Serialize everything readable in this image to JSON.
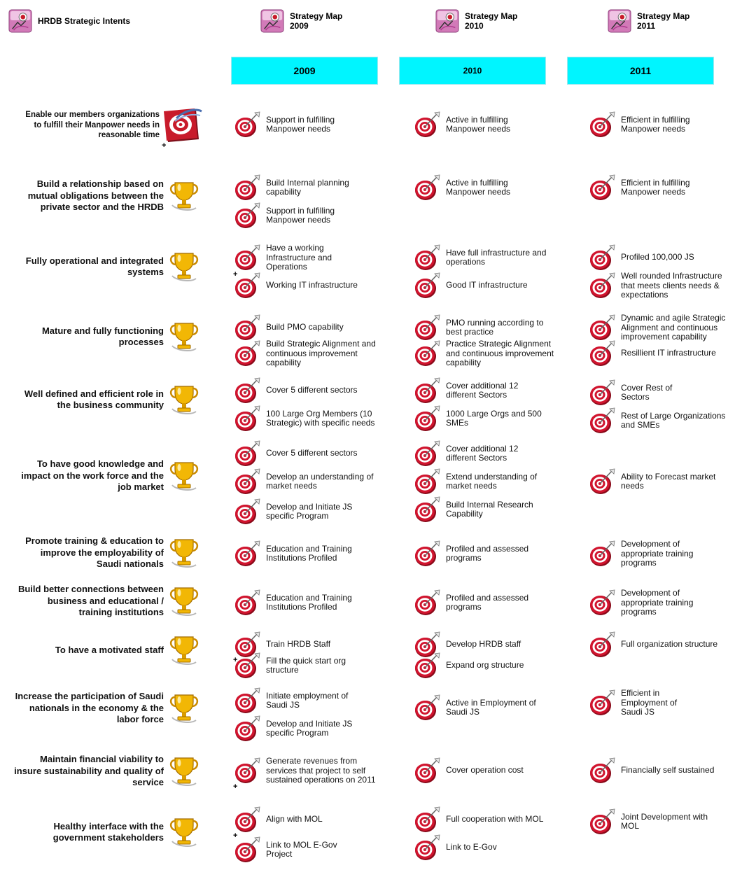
{
  "headers": {
    "intents": "HRDB Strategic Intents",
    "map2009": "Strategy Map\n2009",
    "map2010": "Strategy Map\n2010",
    "map2011": "Strategy Map\n2011"
  },
  "years": [
    "2009",
    "2010",
    "2011"
  ],
  "intents": [
    "Enable our members organizations to fulfill their Manpower  needs in reasonable time",
    "Build a relationship based on mutual obligations between the private sector and the HRDB",
    "Fully operational and integrated systems",
    "Mature and fully functioning processes",
    "Well defined and efficient role in the business community",
    "To have good knowledge and impact on the work force and the job market",
    "Promote training & education to improve the employability of Saudi nationals",
    "Build better connections between business and educational / training institutions",
    "To have a motivated staff",
    "Increase the participation of Saudi nationals in the economy & the labor force",
    "Maintain financial viability to insure sustainability and quality of service",
    "Healthy interface with the government stakeholders"
  ],
  "objectives": {
    "y2009": [
      "Support in fulfilling\nManpower needs",
      "Build Internal planning\ncapability",
      "Support in fulfilling\nManpower needs",
      "Have a working\nInfrastructure and\nOperations",
      "Working IT infrastructure",
      "Build PMO capability",
      "Build Strategic Alignment and\ncontinuous improvement\ncapability",
      "Cover 5 different sectors",
      "100 Large Org Members (10\nStrategic) with specific needs",
      "Cover 5 different sectors",
      "Develop an understanding of\nmarket needs",
      "Develop and Initiate JS\nspecific Program",
      "Education and Training\nInstitutions Profiled",
      "Education and Training\nInstitutions Profiled",
      "Train HRDB Staff",
      "Fill the quick start org\nstructure",
      "Initiate employment of\nSaudi JS",
      "Develop and Initiate JS\nspecific Program",
      "Generate revenues from\nservices that project to self\nsustained operations on 2011",
      "Align with MOL",
      "Link to MOL E-Gov\nProject"
    ],
    "y2010": [
      "Active in fulfilling\nManpower needs",
      "Active in fulfilling\nManpower needs",
      "Have full infrastructure and\noperations",
      "Good IT infrastructure",
      "PMO running according to\nbest practice",
      "Practice Strategic Alignment\nand continuous improvement\ncapability",
      "Cover additional 12\ndifferent Sectors",
      "1000 Large Orgs and 500\nSMEs",
      "Cover additional 12\ndifferent Sectors",
      "Extend understanding of\nmarket needs",
      "Build Internal Research\nCapability",
      "Profiled and assessed\nprograms",
      "Profiled and assessed\nprograms",
      "Develop HRDB staff",
      "Expand org structure",
      "Active in Employment of\nSaudi JS",
      "Cover operation cost",
      "Full cooperation with MOL",
      "Link to E-Gov"
    ],
    "y2011": [
      "Efficient in fulfilling\nManpower needs",
      "Efficient in fulfilling\nManpower needs",
      "Profiled 100,000 JS",
      "Well rounded Infrastructure\nthat meets clients needs &\nexpectations",
      "Dynamic and agile Strategic\nAlignment and continuous\nimprovement capability",
      "Resillient IT infrastructure",
      "Cover Rest of\nSectors",
      "Rest of Large Organizations\nand SMEs",
      "Ability to Forecast market\nneeds",
      "Development of\nappropriate training\nprograms",
      "Development of\nappropriate training\nprograms",
      "Full organization structure",
      "Efficient in\nEmployment of\nSaudi JS",
      "Financially self sustained",
      "Joint Development with\nMOL"
    ]
  },
  "icons": {
    "header": "strategy-map-icon",
    "intent_first": "bullseye-logo-icon",
    "intent": "trophy-icon",
    "objective": "target-dart-icon"
  },
  "colors": {
    "year_band": "#00f5ff",
    "target_red": "#c8102e",
    "trophy_gold": "#e0a800"
  }
}
